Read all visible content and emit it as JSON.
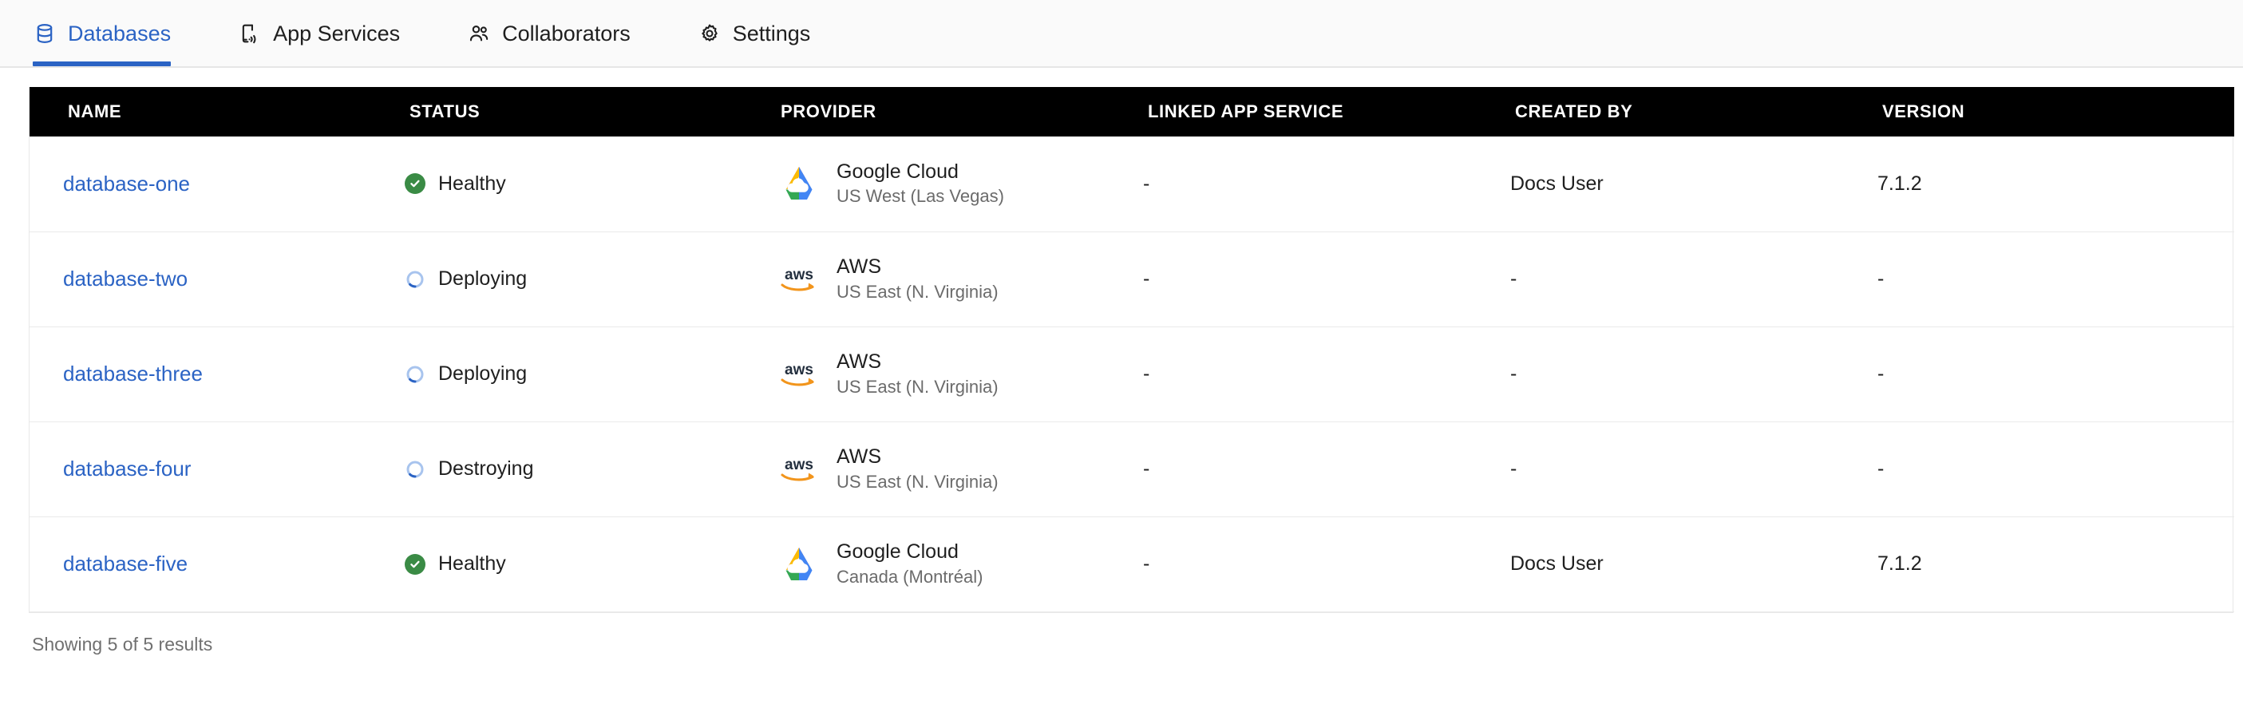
{
  "tabs": [
    {
      "label": "Databases",
      "icon": "database-icon",
      "active": true
    },
    {
      "label": "App Services",
      "icon": "mobile-signal-icon",
      "active": false
    },
    {
      "label": "Collaborators",
      "icon": "users-icon",
      "active": false
    },
    {
      "label": "Settings",
      "icon": "gear-icon",
      "active": false
    }
  ],
  "table": {
    "columns": [
      "NAME",
      "STATUS",
      "PROVIDER",
      "LINKED APP SERVICE",
      "CREATED BY",
      "VERSION"
    ],
    "rows": [
      {
        "name": "database-one",
        "status": "Healthy",
        "status_icon": "check-circle-icon",
        "provider": "Google Cloud",
        "provider_logo": "google-cloud-logo",
        "region": "US West (Las Vegas)",
        "linked_app_service": "-",
        "created_by": "Docs User",
        "version": "7.1.2"
      },
      {
        "name": "database-two",
        "status": "Deploying",
        "status_icon": "spinner-icon",
        "provider": "AWS",
        "provider_logo": "aws-logo",
        "region": "US East (N. Virginia)",
        "linked_app_service": "-",
        "created_by": "-",
        "version": "-"
      },
      {
        "name": "database-three",
        "status": "Deploying",
        "status_icon": "spinner-icon",
        "provider": "AWS",
        "provider_logo": "aws-logo",
        "region": "US East (N. Virginia)",
        "linked_app_service": "-",
        "created_by": "-",
        "version": "-"
      },
      {
        "name": "database-four",
        "status": "Destroying",
        "status_icon": "spinner-icon",
        "provider": "AWS",
        "provider_logo": "aws-logo",
        "region": "US East (N. Virginia)",
        "linked_app_service": "-",
        "created_by": "-",
        "version": "-"
      },
      {
        "name": "database-five",
        "status": "Healthy",
        "status_icon": "check-circle-icon",
        "provider": "Google Cloud",
        "provider_logo": "google-cloud-logo",
        "region": "Canada (Montréal)",
        "linked_app_service": "-",
        "created_by": "Docs User",
        "version": "7.1.2"
      }
    ]
  },
  "footer": {
    "results_text": "Showing 5 of 5 results"
  },
  "colors": {
    "accent_blue": "#2b63c4",
    "healthy_green": "#3a8b45",
    "header_black": "#000000",
    "muted_text": "#6b6b6b",
    "aws_orange": "#f2951c",
    "gcp_red": "#ea4335",
    "gcp_yellow": "#fbbc05",
    "gcp_green": "#34a853",
    "gcp_blue": "#4285f4"
  }
}
